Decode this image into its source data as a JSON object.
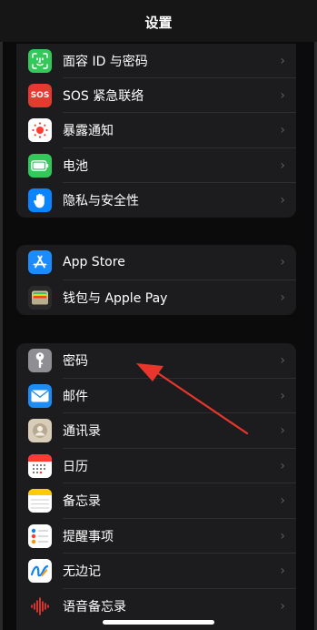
{
  "header": {
    "title": "设置"
  },
  "groups": [
    {
      "items": [
        {
          "label": "面容 ID 与密码",
          "icon": "faceid-icon"
        },
        {
          "label": "SOS 紧急联络",
          "icon": "sos-icon",
          "icon_text": "SOS"
        },
        {
          "label": "暴露通知",
          "icon": "exposure-icon"
        },
        {
          "label": "电池",
          "icon": "battery-icon"
        },
        {
          "label": "隐私与安全性",
          "icon": "hand-icon"
        }
      ]
    },
    {
      "items": [
        {
          "label": "App Store",
          "icon": "appstore-icon"
        },
        {
          "label": "钱包与 Apple Pay",
          "icon": "wallet-icon"
        }
      ]
    },
    {
      "items": [
        {
          "label": "密码",
          "icon": "key-icon"
        },
        {
          "label": "邮件",
          "icon": "mail-icon"
        },
        {
          "label": "通讯录",
          "icon": "contacts-icon"
        },
        {
          "label": "日历",
          "icon": "calendar-icon"
        },
        {
          "label": "备忘录",
          "icon": "notes-icon"
        },
        {
          "label": "提醒事项",
          "icon": "reminders-icon"
        },
        {
          "label": "无边记",
          "icon": "freeform-icon"
        },
        {
          "label": "语音备忘录",
          "icon": "voicememos-icon"
        }
      ]
    }
  ],
  "chevron": "›",
  "colors": {
    "background": "#0b0b0c",
    "group": "#1c1c1e",
    "annotation_arrow": "#e8362d"
  }
}
